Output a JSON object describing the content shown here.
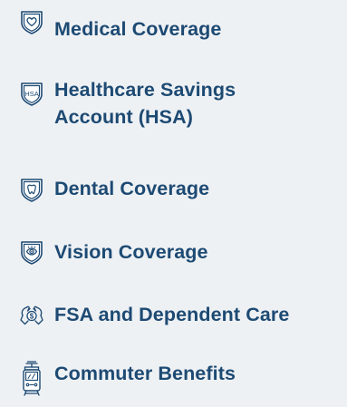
{
  "benefits": {
    "items": [
      {
        "label": "Medical Coverage",
        "icon": "medical-shield-heart-icon"
      },
      {
        "label_line1": "Healthcare Savings",
        "label_line2": "Account (HSA)",
        "icon": "hsa-shield-icon",
        "icon_text": "HSA"
      },
      {
        "label": "Dental Coverage",
        "icon": "dental-shield-tooth-icon"
      },
      {
        "label": "Vision Coverage",
        "icon": "vision-shield-eye-icon"
      },
      {
        "label": "FSA and Dependent Care",
        "icon": "fsa-hands-dollar-icon",
        "icon_text": "$"
      },
      {
        "label": "Commuter Benefits",
        "icon": "commuter-train-icon"
      }
    ]
  },
  "colors": {
    "background": "#eef1f4",
    "text": "#1d4a73",
    "icon_stroke": "#1d4a73",
    "icon_fill": "#ffffff"
  }
}
